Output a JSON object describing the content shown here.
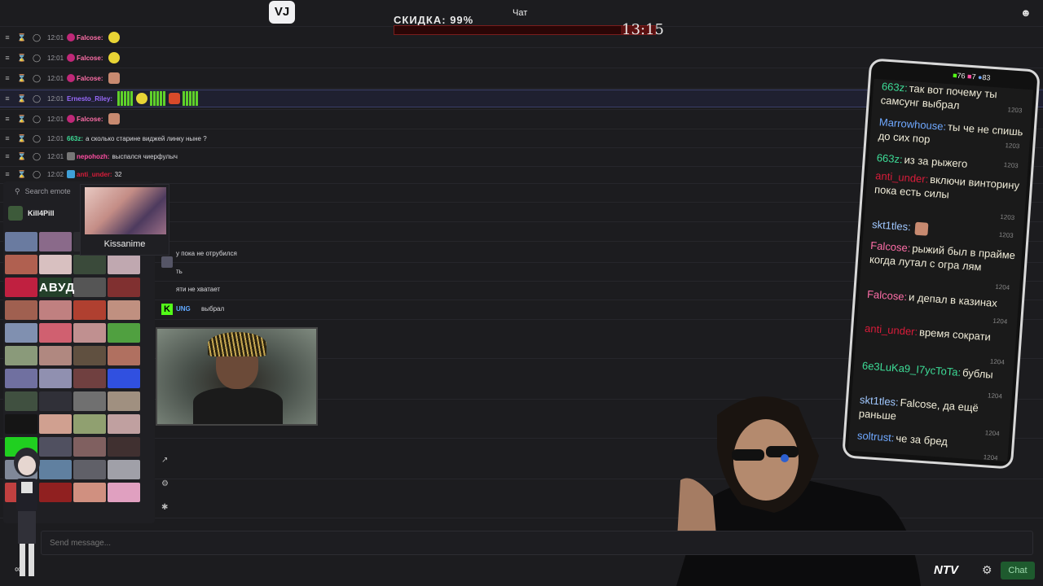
{
  "header": {
    "logo": "VJ",
    "discount": "СКИДКА: 99%",
    "discount_fraction": 0.87,
    "chat_title": "Чат",
    "timer": "13:15"
  },
  "messages": [
    {
      "time": "12:01",
      "user": "Falcose:",
      "text": "",
      "color": "#ff6ea8"
    },
    {
      "time": "12:01",
      "user": "Falcose:",
      "text": "",
      "color": "#ff6ea8"
    },
    {
      "time": "12:01",
      "user": "Falcose:",
      "text": "",
      "color": "#ff6ea8"
    },
    {
      "time": "12:01",
      "user": "Ernesto_Riley:",
      "text": "",
      "color": "#9b6bff"
    },
    {
      "time": "12:01",
      "user": "Falcose:",
      "text": "",
      "color": "#ff6ea8"
    },
    {
      "time": "12:01",
      "user": "663z:",
      "text": "а сколько старине виджей линку ныне ?",
      "color": "#3ddc97"
    },
    {
      "time": "12:01",
      "user": "nepohozh:",
      "text": "выспался чиерфулыч",
      "color": "#ff4fa3"
    },
    {
      "time": "12:02",
      "user": "anti_under:",
      "text": "32",
      "color": "#d91c3a"
    }
  ],
  "picker": {
    "search_placeholder": "Search emote",
    "channel": "Kill4Pill",
    "tooltip": "Kissanime",
    "avud": "АВУД"
  },
  "fragments": [
    "у пока не отрубился",
    "ть",
    "яти не хватает",
    "UNG",
    "выбрал"
  ],
  "send": {
    "placeholder": "Send message..."
  },
  "phone": {
    "status_green": "76",
    "status_pink": "7",
    "status_blue": "83",
    "messages": [
      {
        "user": "663z:",
        "text": "так вот почему ты самсунг выбрал",
        "time": "1203",
        "color": "#3ddc97"
      },
      {
        "user": "Marrowhouse:",
        "text": "ты че не спишь до сих пор",
        "time": "1203",
        "color": "#6fa8ff"
      },
      {
        "user": "663z:",
        "text": "из за рыжего",
        "time": "1203",
        "color": "#3ddc97"
      },
      {
        "user": "anti_under:",
        "text": "включи винторину пока есть силы",
        "time": "1203",
        "color": "#d91c3a"
      },
      {
        "user": "skt1tles:",
        "text": "",
        "time": "1203",
        "color": "#a0c8ff"
      },
      {
        "user": "Falcose:",
        "text": "рыжий был в прайме когда лутал с огра лям",
        "time": "1204",
        "color": "#ff6ea8"
      },
      {
        "user": "Falcose:",
        "text": "и депал в казинах",
        "time": "1204",
        "color": "#ff6ea8"
      },
      {
        "user": "anti_under:",
        "text": "время сократи",
        "time": "1204",
        "color": "#d91c3a"
      },
      {
        "user": "6e3LuKa9_I7ycToTa:",
        "text": "бублы",
        "time": "1204",
        "color": "#3ddc97"
      },
      {
        "user": "skt1tles:",
        "text": "Falcose, да ещё раньше",
        "time": "1204",
        "color": "#a0c8ff"
      },
      {
        "user": "soltrust:",
        "text": "че за бред",
        "time": "1204",
        "color": "#6fa8ff"
      }
    ]
  },
  "footer": {
    "ntv": "NTV",
    "chat_button": "Chat",
    "infinity": "∞"
  }
}
